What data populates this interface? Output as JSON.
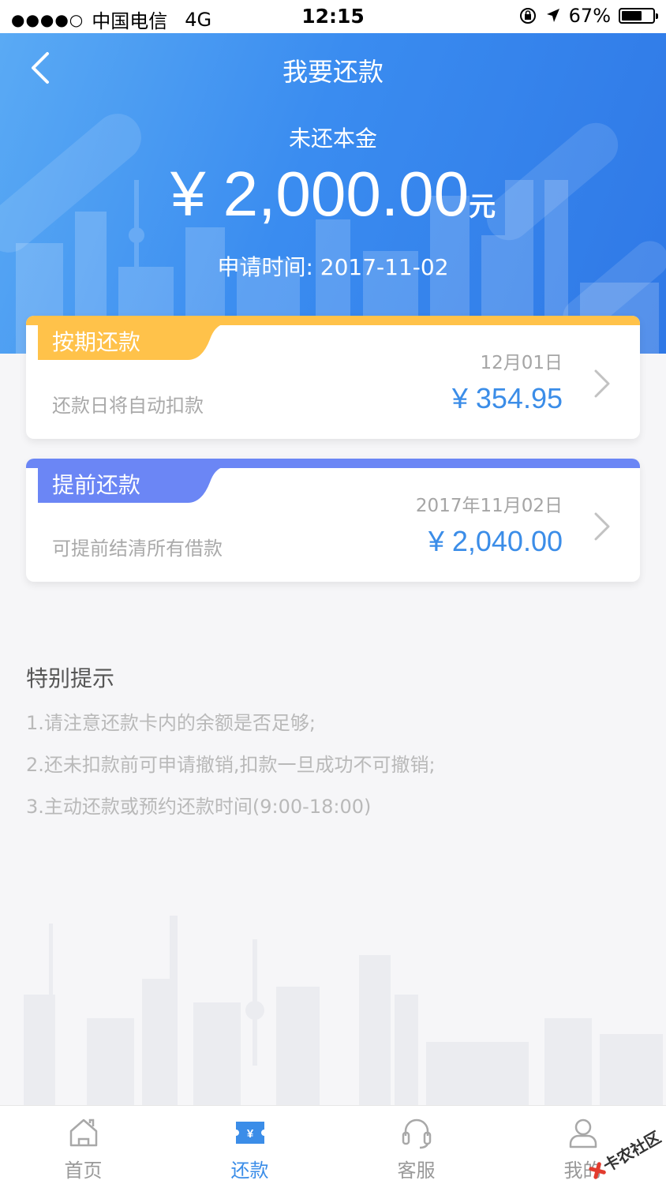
{
  "status_bar": {
    "signal": "●●●●○",
    "carrier": "中国电信",
    "network": "4G",
    "time": "12:15",
    "battery_text": "67%",
    "battery_level": 0.67
  },
  "header": {
    "title": "我要还款",
    "principal_label": "未还本金",
    "principal_amount": "¥ 2,000.00",
    "principal_unit": "元",
    "apply_time": "申请时间: 2017-11-02"
  },
  "cards": [
    {
      "tab_label": "按期还款",
      "date": "12月01日",
      "description": "还款日将自动扣款",
      "amount": "¥ 354.95",
      "tab_color": "#ffc24a"
    },
    {
      "tab_label": "提前还款",
      "date": "2017年11月02日",
      "description": "可提前结清所有借款",
      "amount": "¥ 2,040.00",
      "tab_color": "#6b86f5"
    }
  ],
  "tips": {
    "title": "特别提示",
    "items": [
      "1.请注意还款卡内的余额是否足够;",
      "2.还未扣款前可申请撤销,扣款一旦成功不可撤销;",
      "3.主动还款或预约还款时间(9:00-18:00)"
    ]
  },
  "tabbar": {
    "items": [
      {
        "label": "首页",
        "icon": "home-icon"
      },
      {
        "label": "还款",
        "icon": "repay-ticket-icon"
      },
      {
        "label": "客服",
        "icon": "headset-icon"
      },
      {
        "label": "我的",
        "icon": "user-icon"
      }
    ],
    "active_index": 1
  },
  "watermark": {
    "text": "卡农社区"
  },
  "colors": {
    "accent": "#3b8de8",
    "hero_start": "#5aaaf4",
    "hero_end": "#2f78e6"
  }
}
